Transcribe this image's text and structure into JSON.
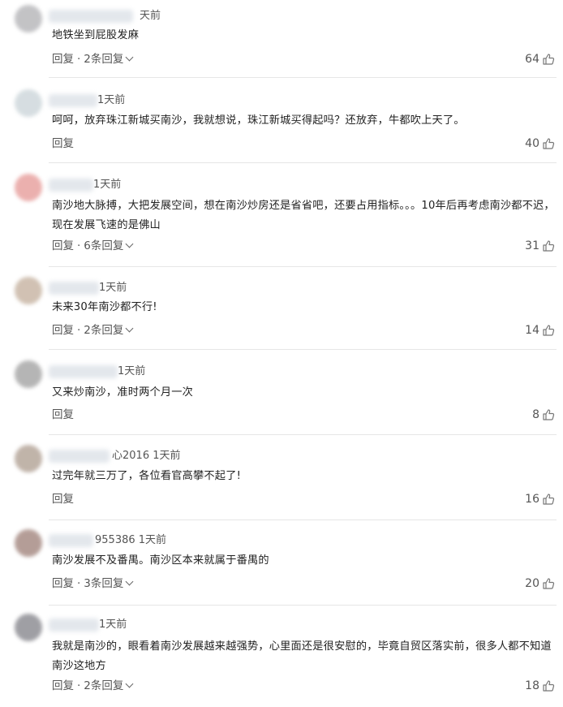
{
  "comments": [
    {
      "time": "天前",
      "text": "地铁坐到屁股发麻",
      "reply_label": "回复",
      "sep": "·",
      "replies_label": "2条回复",
      "likes": "64",
      "avatar_color": "#b9b9bc"
    },
    {
      "time": "1天前",
      "text": "呵呵，放弃珠江新城买南沙，我就想说，珠江新城买得起吗？还放弃，牛都吹上天了。",
      "reply_label": "回复",
      "sep": "",
      "replies_label": "",
      "likes": "40",
      "avatar_color": "#cfd8dc"
    },
    {
      "time": "1天前",
      "text": "南沙地大脉搏，大把发展空间，想在南沙炒房还是省省吧，还要占用指标。。。10年后再考虑南沙都不迟，现在发展飞速的是佛山",
      "reply_label": "回复",
      "sep": "·",
      "replies_label": "6条回复",
      "likes": "31",
      "avatar_color": "#e8a3a1"
    },
    {
      "time": "1天前",
      "text": "未来30年南沙都不行!",
      "reply_label": "回复",
      "sep": "·",
      "replies_label": "2条回复",
      "likes": "14",
      "avatar_color": "#c9b7a6"
    },
    {
      "time": "1天前",
      "text": "又来炒南沙，准时两个月一次",
      "reply_label": "回复",
      "sep": "",
      "replies_label": "",
      "likes": "8",
      "avatar_color": "#a9a9a9"
    },
    {
      "time": "心2016 1天前",
      "text": "过完年就三万了，各位看官高攀不起了!",
      "reply_label": "回复",
      "sep": "",
      "replies_label": "",
      "likes": "16",
      "avatar_color": "#b6a79b"
    },
    {
      "time": "955386 1天前",
      "text": "南沙发展不及番禺。南沙区本来就属于番禺的",
      "reply_label": "回复",
      "sep": "·",
      "replies_label": "3条回复",
      "likes": "20",
      "avatar_color": "#a88d86"
    },
    {
      "time": "1天前",
      "text": "我就是南沙的，眼看着南沙发展越来越强势，心里面还是很安慰的，毕竟自贸区落实前，很多人都不知道南沙这地方",
      "reply_label": "回复",
      "sep": "·",
      "replies_label": "2条回复",
      "likes": "18",
      "avatar_color": "#8f8f95"
    }
  ],
  "icons": {
    "thumb": "thumbs-up-icon",
    "expand": "chevron-down-icon"
  }
}
